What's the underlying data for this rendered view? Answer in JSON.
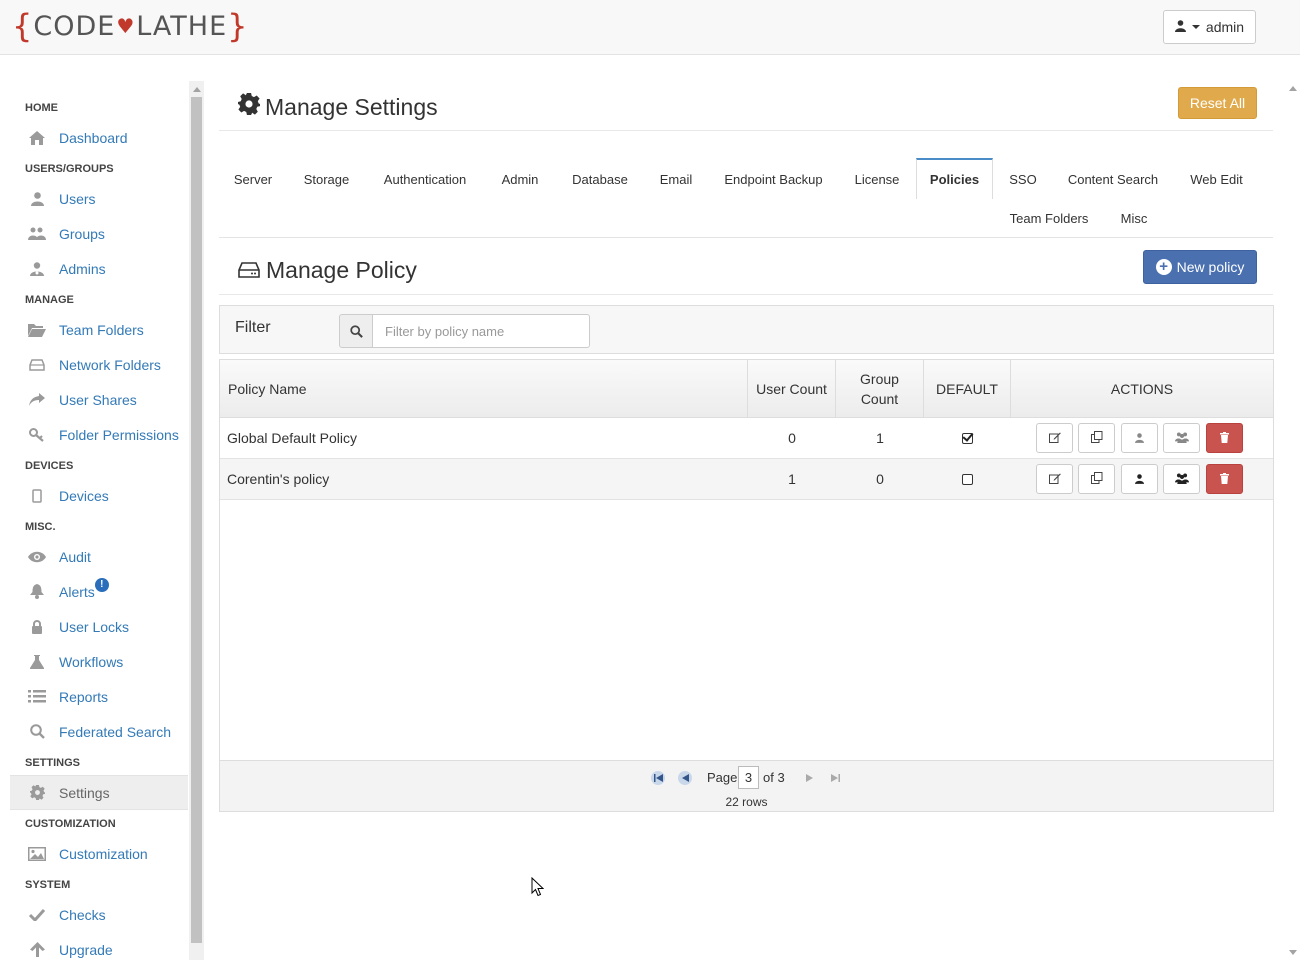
{
  "header": {
    "logo_left_brace": "{",
    "logo_part1": "CODE",
    "logo_part2": "LATHE",
    "logo_right_brace": "}",
    "user_label": "admin"
  },
  "sidebar": {
    "sections": {
      "home": "HOME",
      "users_groups": "USERS/GROUPS",
      "manage": "MANAGE",
      "devices": "DEVICES",
      "misc": "MISC.",
      "settings": "SETTINGS",
      "customization": "CUSTOMIZATION",
      "system": "SYSTEM"
    },
    "items": {
      "dashboard": "Dashboard",
      "users": "Users",
      "groups": "Groups",
      "admins": "Admins",
      "team_folders": "Team Folders",
      "network_folders": "Network Folders",
      "user_shares": "User Shares",
      "folder_permissions": "Folder Permissions",
      "devices": "Devices",
      "audit": "Audit",
      "alerts": "Alerts",
      "alerts_badge": "!",
      "user_locks": "User Locks",
      "workflows": "Workflows",
      "reports": "Reports",
      "federated_search": "Federated Search",
      "settings": "Settings",
      "customization": "Customization",
      "checks": "Checks",
      "upgrade": "Upgrade"
    },
    "active_item": "Settings"
  },
  "main": {
    "title": "Manage Settings",
    "reset_all_label": "Reset All",
    "tabs": [
      "Server",
      "Storage",
      "Authentication",
      "Admin",
      "Database",
      "Email",
      "Endpoint Backup",
      "License",
      "Policies",
      "SSO",
      "Content Search",
      "Web Edit",
      "Team Folders",
      "Misc"
    ],
    "active_tab": "Policies",
    "section_title": "Manage Policy",
    "new_policy_label": "New policy",
    "filter": {
      "label": "Filter",
      "placeholder": "Filter by policy name",
      "value": ""
    },
    "table": {
      "columns": {
        "policy_name": "Policy Name",
        "user_count": "User Count",
        "group_count_line1": "Group",
        "group_count_line2": "Count",
        "default": "DEFAULT",
        "actions": "ACTIONS"
      },
      "rows": [
        {
          "name": "Global Default Policy",
          "user_count": "0",
          "group_count": "1",
          "default": true
        },
        {
          "name": "Corentin's policy",
          "user_count": "1",
          "group_count": "0",
          "default": false
        }
      ],
      "row_actions": [
        "edit-icon",
        "copy-icon",
        "user-icon",
        "users-icon",
        "trash-icon"
      ]
    },
    "pagination": {
      "page_label": "Page",
      "current_page": "3",
      "of_label": "of 3",
      "rows_label": "22 rows"
    }
  },
  "colors": {
    "link": "#337ab7",
    "warning": "#e0a94b",
    "primary": "#4a70b0",
    "danger": "#c9534f",
    "logo_accent": "#c0392b"
  }
}
